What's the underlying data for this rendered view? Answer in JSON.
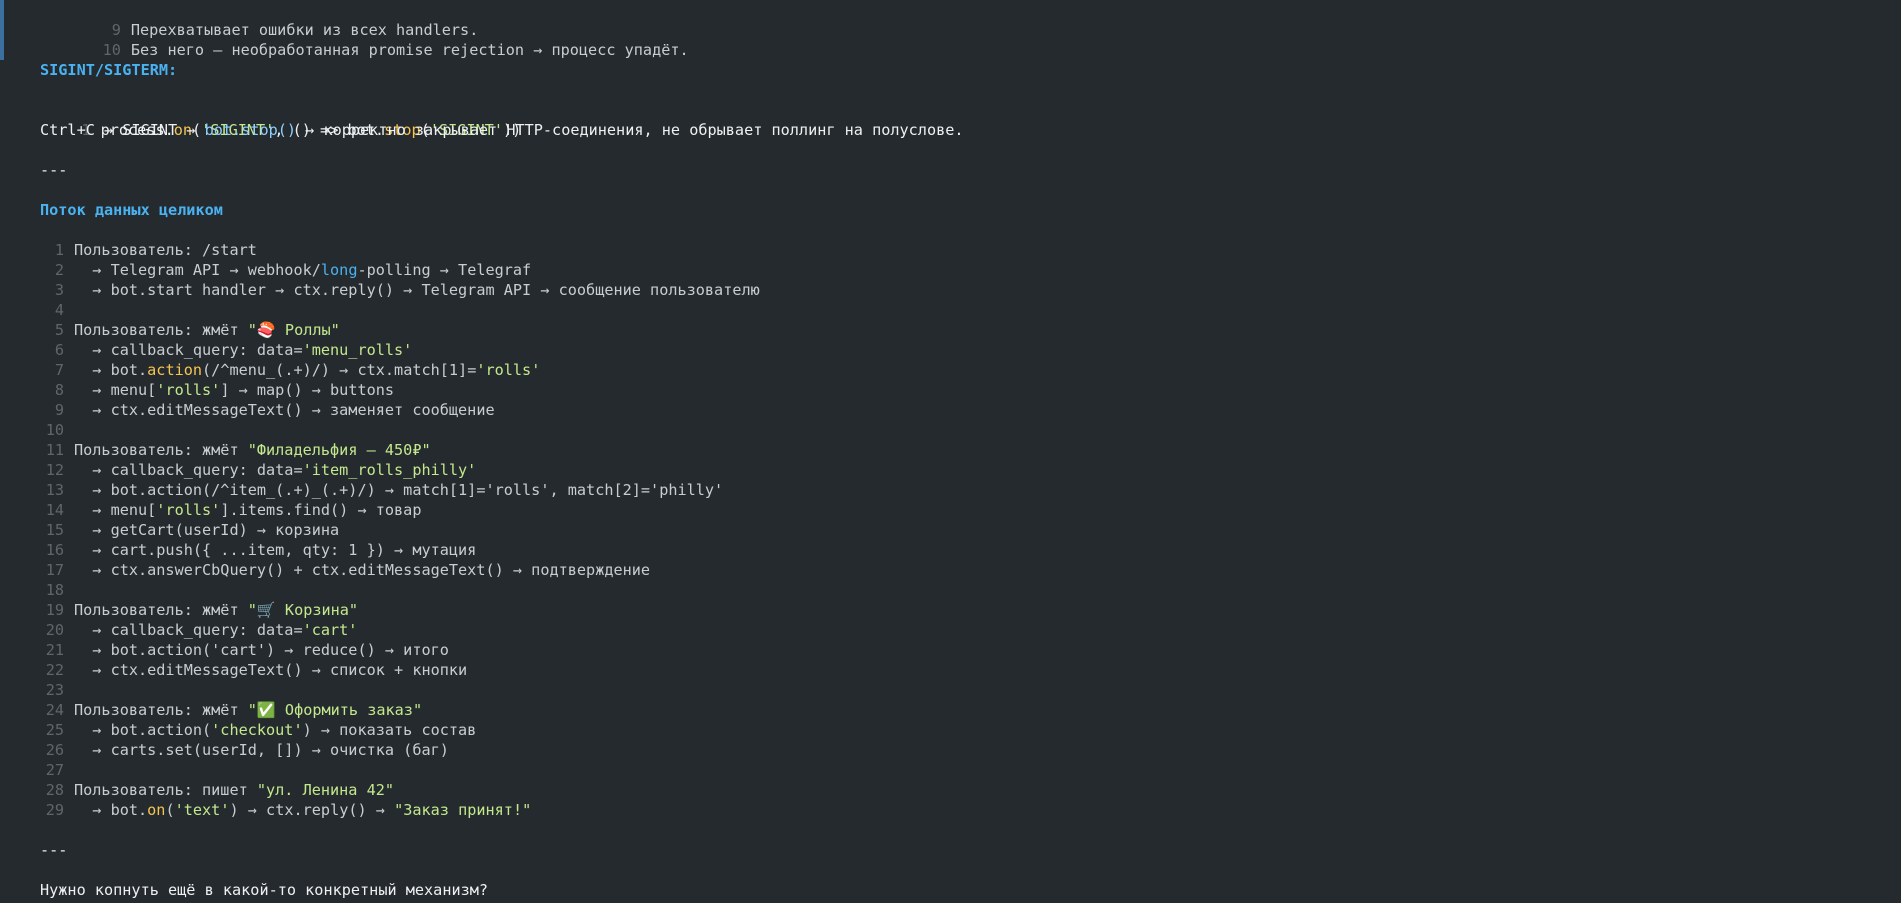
{
  "top_block": [
    {
      "num": "9",
      "text": "Перехватывает ошибки из всех handlers."
    },
    {
      "num": "10",
      "text": "Без него — необработанная promise rejection → процесс упадёт."
    }
  ],
  "sigint_heading": "SIGINT/SIGTERM:",
  "sigint_code": {
    "num": "1",
    "p1": "process.",
    "p2": "on",
    "p3": "(",
    "p4": "'SIGINT'",
    "p5": ", () => bot.",
    "p6": "stop",
    "p7": "(",
    "p8": "'SIGINT'",
    "p9": "))"
  },
  "sigint_text": {
    "a": "Ctrl+C → SIGINT → ",
    "b": "bot.stop()",
    "c": " → корректно закрывает HTTP-соединения, не обрывает поллинг на полуслове."
  },
  "separator1": "---",
  "flow_heading": "Поток данных целиком",
  "flow": {
    "l1": {
      "num": "1",
      "text": "Пользователь: /start"
    },
    "l2": {
      "num": "2",
      "a": "  → Telegram API → webhook/",
      "b": "long",
      "c": "-polling → Telegraf"
    },
    "l3": {
      "num": "3",
      "text": "  → bot.start handler → ctx.reply() → Telegram API → сообщение пользователю"
    },
    "l4": {
      "num": "4"
    },
    "l5": {
      "num": "5",
      "a": "Пользователь: жмёт ",
      "b": "\"🍣 Роллы\""
    },
    "l6": {
      "num": "6",
      "a": "  → callback_query: data=",
      "b": "'menu_rolls'"
    },
    "l7": {
      "num": "7",
      "a": "  → bot.",
      "b": "action",
      "c": "(/^menu_(.+)/) → ctx.match[1]=",
      "d": "'rolls'"
    },
    "l8": {
      "num": "8",
      "a": "  → menu[",
      "b": "'rolls'",
      "c": "] → map() → buttons"
    },
    "l9": {
      "num": "9",
      "text": "  → ctx.editMessageText() → заменяет сообщение"
    },
    "l10": {
      "num": "10"
    },
    "l11": {
      "num": "11",
      "a": "Пользователь: жмёт ",
      "b": "\"Филадельфия — 450₽\""
    },
    "l12": {
      "num": "12",
      "a": "  → callback_query: data=",
      "b": "'item_rolls_philly'"
    },
    "l13": {
      "num": "13",
      "text": "  → bot.action(/^item_(.+)_(.+)/) → match[1]='rolls', match[2]='philly'"
    },
    "l14": {
      "num": "14",
      "a": "  → menu[",
      "b": "'rolls'",
      "c": "].items.find() → товар"
    },
    "l15": {
      "num": "15",
      "text": "  → getCart(userId) → корзина"
    },
    "l16": {
      "num": "16",
      "text": "  → cart.push({ ...item, qty: 1 }) → мутация"
    },
    "l17": {
      "num": "17",
      "text": "  → ctx.answerCbQuery() + ctx.editMessageText() → подтверждение"
    },
    "l18": {
      "num": "18"
    },
    "l19": {
      "num": "19",
      "a": "Пользователь: жмёт ",
      "b": "\"🛒 Корзина\""
    },
    "l20": {
      "num": "20",
      "a": "  → callback_query: data=",
      "b": "'cart'"
    },
    "l21": {
      "num": "21",
      "text": "  → bot.action('cart') → reduce() → итого"
    },
    "l22": {
      "num": "22",
      "text": "  → ctx.editMessageText() → список + кнопки"
    },
    "l23": {
      "num": "23"
    },
    "l24": {
      "num": "24",
      "a": "Пользователь: жмёт ",
      "b": "\"✅ Оформить заказ\""
    },
    "l25": {
      "num": "25",
      "a": "  → bot.action(",
      "b": "'checkout'",
      "c": ") → показать состав"
    },
    "l26": {
      "num": "26",
      "text": "  → carts.set(userId, []) → очистка (баг)"
    },
    "l27": {
      "num": "27"
    },
    "l28": {
      "num": "28",
      "a": "Пользователь: пишет ",
      "b": "\"ул. Ленина 42\""
    },
    "l29": {
      "num": "29",
      "a": "  → bot.",
      "b": "on",
      "c": "(",
      "d": "'text'",
      "e": ") → ctx.reply() → ",
      "f": "\"Заказ принят!\""
    }
  },
  "separator2": "---",
  "closing_question": "Нужно копнуть ещё в какой-то конкретный механизм?",
  "colors": {
    "background": "#252a2e",
    "heading": "#4ab2f1",
    "string": "#c3e88d",
    "function": "#f5c451",
    "line_number": "#5f6669"
  }
}
